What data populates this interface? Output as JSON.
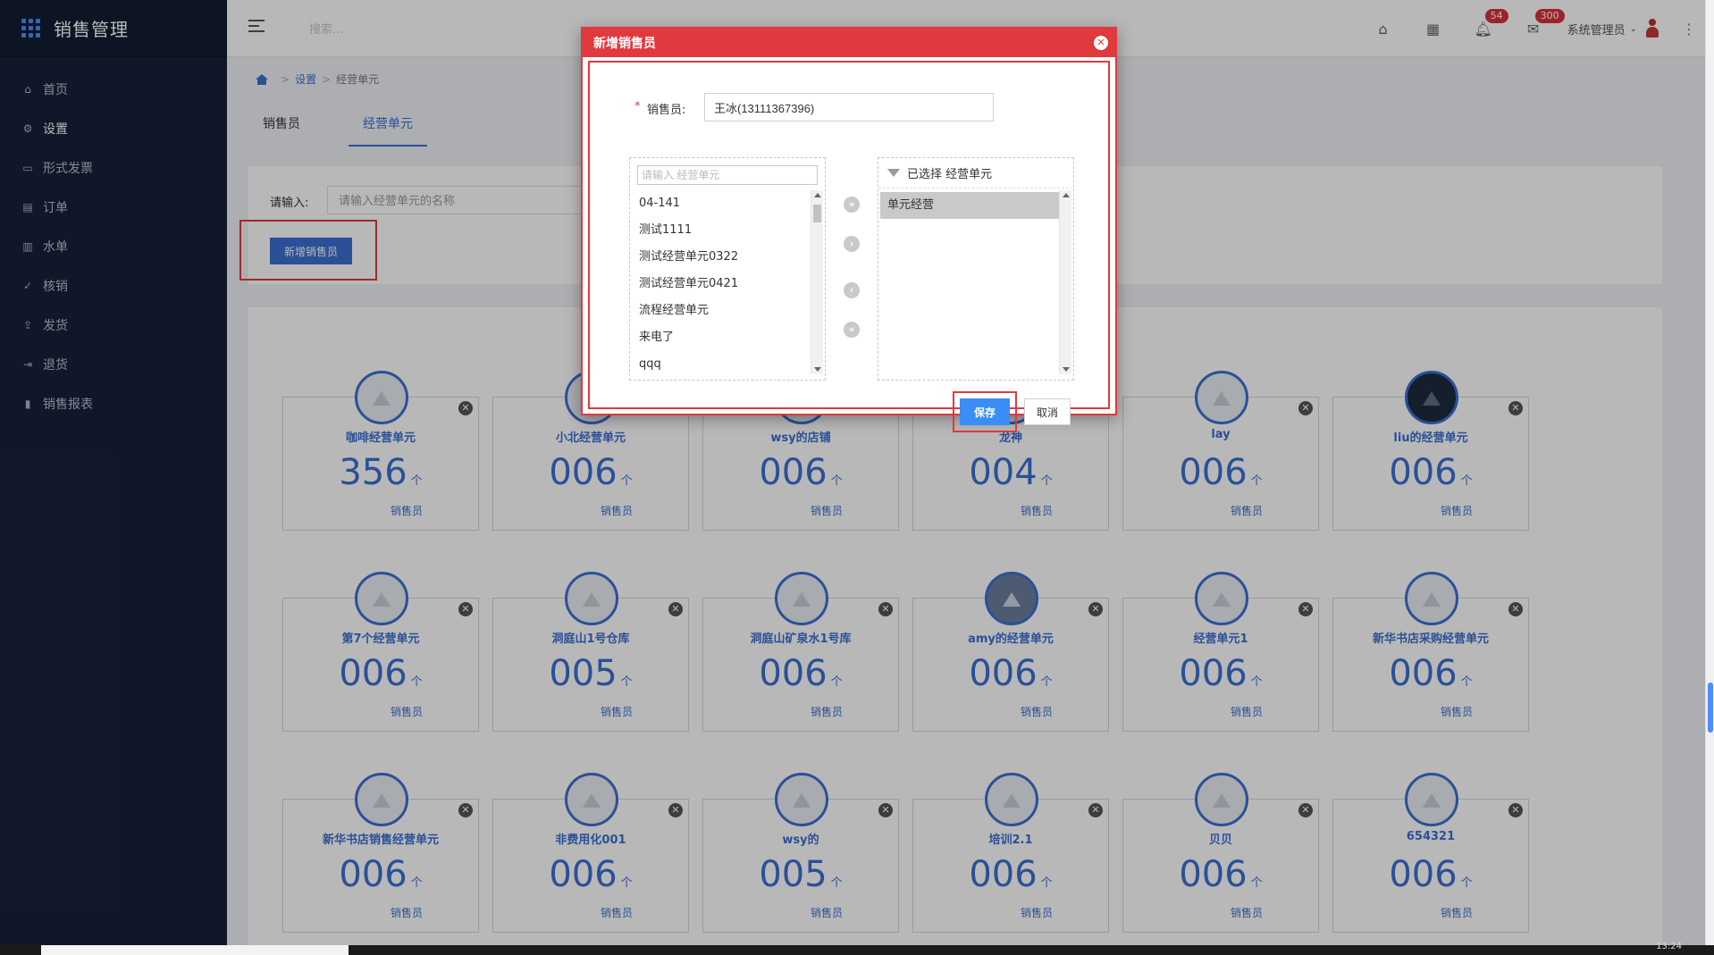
{
  "app": {
    "title": "销售管理"
  },
  "sidebar": {
    "items": [
      {
        "label": "首页",
        "icon": "home-icon"
      },
      {
        "label": "设置",
        "icon": "gear-icon"
      },
      {
        "label": "形式发票",
        "icon": "invoice-icon"
      },
      {
        "label": "订单",
        "icon": "order-icon"
      },
      {
        "label": "水单",
        "icon": "receipt-icon"
      },
      {
        "label": "核销",
        "icon": "check-circle-icon"
      },
      {
        "label": "发货",
        "icon": "upload-icon"
      },
      {
        "label": "退货",
        "icon": "return-icon"
      },
      {
        "label": "销售报表",
        "icon": "bar-chart-icon"
      }
    ]
  },
  "header": {
    "search_placeholder": "搜索...",
    "notifications_badge": "54",
    "messages_badge": "300",
    "user_name": "系统管理员"
  },
  "breadcrumb": {
    "items": [
      "设置",
      "经营单元"
    ]
  },
  "tabs": [
    {
      "label": "销售员"
    },
    {
      "label": "经营单元"
    }
  ],
  "search_panel": {
    "label": "请输入:",
    "placeholder": "请输入经营单元的名称",
    "add_button": "新增销售员"
  },
  "cards": [
    {
      "name": "咖啡经营单元",
      "count": "356",
      "unit": "个",
      "role": "销售员"
    },
    {
      "name": "小北经营单元",
      "count": "006",
      "unit": "个",
      "role": "销售员"
    },
    {
      "name": "wsy的店铺",
      "count": "006",
      "unit": "个",
      "role": "销售员"
    },
    {
      "name": "龙神",
      "count": "004",
      "unit": "个",
      "role": "销售员"
    },
    {
      "name": "lay",
      "count": "006",
      "unit": "个",
      "role": "销售员"
    },
    {
      "name": "liu的经营单元",
      "count": "006",
      "unit": "个",
      "role": "销售员"
    },
    {
      "name": "第7个经营单元",
      "count": "006",
      "unit": "个",
      "role": "销售员"
    },
    {
      "name": "洞庭山1号仓库",
      "count": "005",
      "unit": "个",
      "role": "销售员"
    },
    {
      "name": "洞庭山矿泉水1号库",
      "count": "006",
      "unit": "个",
      "role": "销售员"
    },
    {
      "name": "amy的经营单元",
      "count": "006",
      "unit": "个",
      "role": "销售员"
    },
    {
      "name": "经营单元1",
      "count": "006",
      "unit": "个",
      "role": "销售员"
    },
    {
      "name": "新华书店采购经营单元",
      "count": "006",
      "unit": "个",
      "role": "销售员"
    },
    {
      "name": "新华书店销售经营单元",
      "count": "006",
      "unit": "个",
      "role": "销售员"
    },
    {
      "name": "非费用化001",
      "count": "006",
      "unit": "个",
      "role": "销售员"
    },
    {
      "name": "wsy的",
      "count": "005",
      "unit": "个",
      "role": "销售员"
    },
    {
      "name": "培训2.1",
      "count": "006",
      "unit": "个",
      "role": "销售员"
    },
    {
      "name": "贝贝",
      "count": "006",
      "unit": "个",
      "role": "销售员"
    },
    {
      "name": "654321",
      "count": "006",
      "unit": "个",
      "role": "销售员"
    }
  ],
  "modal": {
    "title": "新增销售员",
    "field_label": "销售员:",
    "field_value": "王冰(13111367396)",
    "left_search_placeholder": "请输入 经营单元",
    "left_items": [
      "04-141",
      "测试1111",
      "测试经营单元0322",
      "测试经营单元0421",
      "流程经营单元",
      "来电了",
      "qqq"
    ],
    "right_header": "已选择 经营单元",
    "right_items": [
      "单元经营"
    ],
    "save_button": "保存",
    "cancel_button": "取消"
  },
  "taskbar": {
    "clock": "13:24"
  },
  "colors": {
    "accent": "#3b6fd1",
    "sidebar": "#16213a",
    "highlight": "#e0393e"
  }
}
